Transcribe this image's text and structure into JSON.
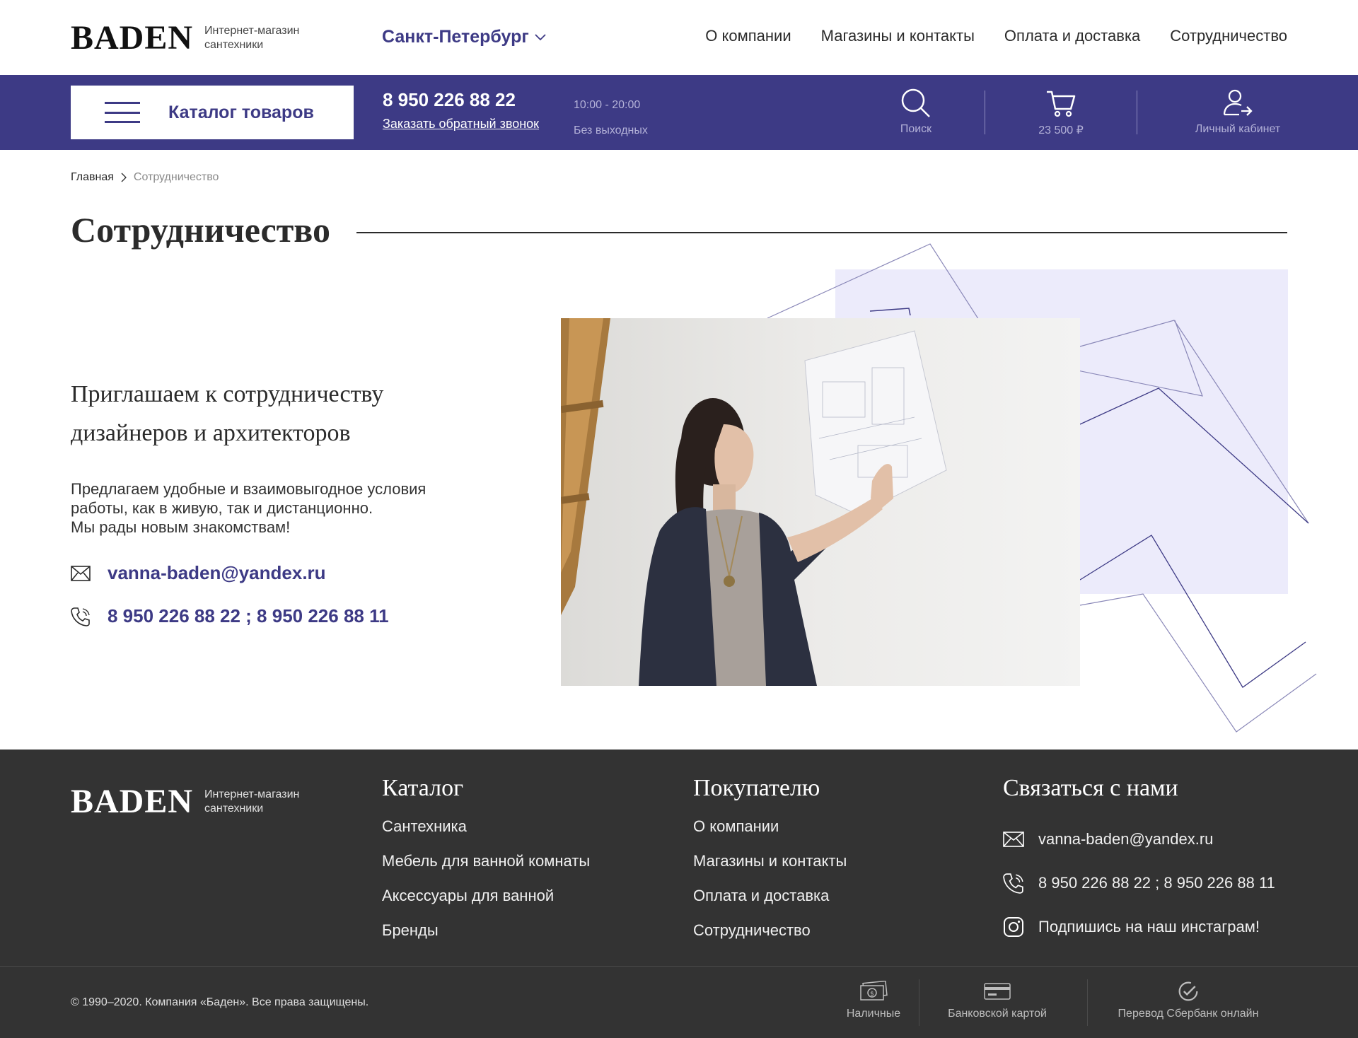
{
  "header": {
    "logo": "BADEN",
    "logo_subtitle": "Интернет-магазин сантехники",
    "city": "Санкт-Петербург",
    "nav": [
      "О компании",
      "Магазины и контакты",
      "Оплата и доставка",
      "Сотрудничество"
    ]
  },
  "bar": {
    "catalog_label": "Каталог товаров",
    "phone": "8 950 226 88 22",
    "callback_label": "Заказать обратный звонок",
    "hours": "10:00 - 20:00",
    "days": "Без выходных",
    "search_label": "Поиск",
    "cart_total": "23 500 ₽",
    "account_label": "Личный кабинет"
  },
  "breadcrumb": {
    "home": "Главная",
    "current": "Сотрудничество"
  },
  "page": {
    "title": "Сотрудничество",
    "invite_line1": "Приглашаем к сотрудничеству",
    "invite_line2": "дизайнеров и архитекторов",
    "offer_line1": "Предлагаем удобные и взаимовыгодное условия",
    "offer_line2": "работы,  как в живую,  так и дистанционно.",
    "offer_line3": "Мы рады новым знакомствам!",
    "email": "vanna-baden@yandex.ru",
    "phones": "8 950 226 88 22 ; 8 950 226 88 11"
  },
  "footer": {
    "logo": "BADEN",
    "logo_subtitle": "Интернет-магазин сантехники",
    "catalog_title": "Каталог",
    "catalog_links": [
      "Сантехника",
      "Мебель для ванной комнаты",
      "Аксессуары для ванной",
      "Бренды"
    ],
    "buyer_title": "Покупателю",
    "buyer_links": [
      "О компании",
      "Магазины и контакты",
      "Оплата и доставка",
      "Сотрудничество"
    ],
    "contact_title": "Связаться с нами",
    "email": "vanna-baden@yandex.ru",
    "phones": "8 950 226 88 22 ; 8 950 226 88 11",
    "instagram": "Подпишись на наш инстаграм!",
    "copyright": "© 1990–2020. Компания «Баден». Все права защищены.",
    "payments": [
      "Наличные",
      "Банковской картой",
      "Перевод Сбербанк онлайн"
    ]
  },
  "colors": {
    "brand": "#3d3a85",
    "lilac": "#ecebfb",
    "footer_bg": "#333333"
  }
}
